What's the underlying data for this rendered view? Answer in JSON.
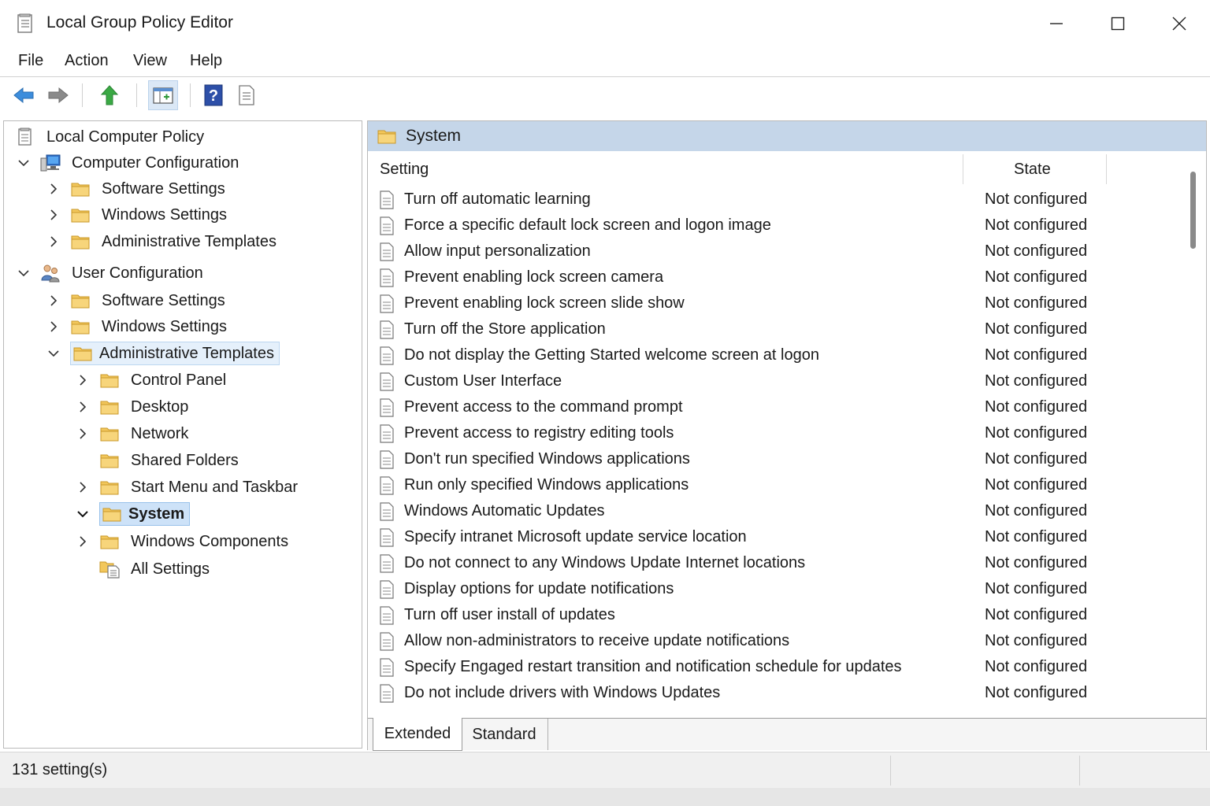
{
  "window": {
    "title": "Local Group Policy Editor",
    "controls": [
      "minimize",
      "maximize",
      "close"
    ]
  },
  "menu": [
    "File",
    "Action",
    "View",
    "Help"
  ],
  "toolbar": {
    "icons": [
      "back-arrow-icon",
      "forward-arrow-icon",
      "up-arrow-icon",
      "show-hide-console-tree-icon",
      "help-icon",
      "properties-icon"
    ]
  },
  "tree": {
    "root": "Local Computer Policy",
    "computer_configuration": {
      "label": "Computer Configuration",
      "children": [
        "Software Settings",
        "Windows Settings",
        "Administrative Templates"
      ]
    },
    "user_configuration": {
      "label": "User Configuration",
      "children": [
        "Software Settings",
        "Windows Settings",
        "Administrative Templates"
      ]
    },
    "admin_templates_children": [
      "Control Panel",
      "Desktop",
      "Network",
      "Shared Folders",
      "Start Menu and Taskbar",
      "System",
      "Windows Components",
      "All Settings"
    ],
    "selected": "System"
  },
  "details": {
    "title": "System",
    "columns": {
      "setting": "Setting",
      "state": "State"
    },
    "rows": [
      {
        "name": "Turn off automatic learning",
        "state": "Not configured"
      },
      {
        "name": "Force a specific default lock screen and logon image",
        "state": "Not configured"
      },
      {
        "name": "Allow input personalization",
        "state": "Not configured"
      },
      {
        "name": "Prevent enabling lock screen camera",
        "state": "Not configured"
      },
      {
        "name": "Prevent enabling lock screen slide show",
        "state": "Not configured"
      },
      {
        "name": "Turn off the Store application",
        "state": "Not configured"
      },
      {
        "name": "Do not display the Getting Started welcome screen at logon",
        "state": "Not configured"
      },
      {
        "name": "Custom User Interface",
        "state": "Not configured"
      },
      {
        "name": "Prevent access to the command prompt",
        "state": "Not configured"
      },
      {
        "name": "Prevent access to registry editing tools",
        "state": "Not configured"
      },
      {
        "name": "Don't run specified Windows applications",
        "state": "Not configured"
      },
      {
        "name": "Run only specified Windows applications",
        "state": "Not configured"
      },
      {
        "name": "Windows Automatic Updates",
        "state": "Not configured"
      },
      {
        "name": "Specify intranet Microsoft update service location",
        "state": "Not configured"
      },
      {
        "name": "Do not connect to any Windows Update Internet locations",
        "state": "Not configured"
      },
      {
        "name": "Display options for update notifications",
        "state": "Not configured"
      },
      {
        "name": "Turn off user install of updates",
        "state": "Not configured"
      },
      {
        "name": "Allow non-administrators to receive update notifications",
        "state": "Not configured"
      },
      {
        "name": "Specify Engaged restart transition and notification schedule for updates",
        "state": "Not configured"
      },
      {
        "name": "Do not include drivers with Windows Updates",
        "state": "Not configured"
      }
    ],
    "tabs": [
      "Extended",
      "Standard"
    ],
    "active_tab": "Extended"
  },
  "status": {
    "text": "131 setting(s)"
  },
  "colors": {
    "header_band": "#c5d6e9",
    "selection_strong": "#cde2f8",
    "selection_light": "#e5f0fb",
    "folder": "#f2c75c"
  }
}
